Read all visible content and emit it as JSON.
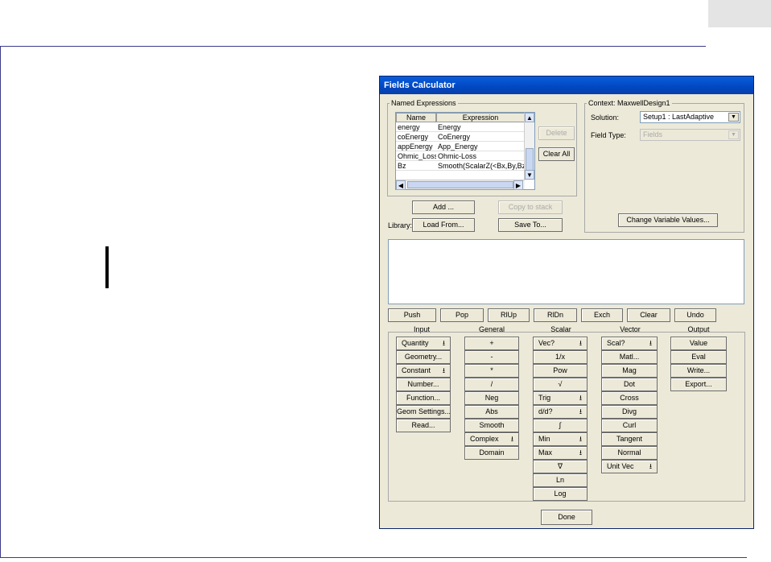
{
  "dialog": {
    "title": "Fields Calculator",
    "named_expressions": {
      "legend": "Named Expressions",
      "columns": [
        "Name",
        "Expression"
      ],
      "rows": [
        {
          "name": "energy",
          "expr": "Energy"
        },
        {
          "name": "coEnergy",
          "expr": "CoEnergy"
        },
        {
          "name": "appEnergy",
          "expr": "App_Energy"
        },
        {
          "name": "Ohmic_Loss",
          "expr": "Ohmic-Loss"
        },
        {
          "name": "Bz",
          "expr": "Smooth(ScalarZ(<Bx,By,Bz>))"
        }
      ],
      "delete": "Delete",
      "clear_all": "Clear All"
    },
    "context": {
      "legend": "Context: MaxwellDesign1",
      "solution_label": "Solution:",
      "solution_value": "Setup1 : LastAdaptive",
      "field_type_label": "Field Type:",
      "field_type_value": "Fields",
      "change_vars": "Change Variable Values..."
    },
    "add": "Add ...",
    "copy_to_stack": "Copy to stack",
    "library_label": "Library:",
    "load_from": "Load From...",
    "save_to": "Save To...",
    "stack_buttons": [
      "Push",
      "Pop",
      "RlUp",
      "RlDn",
      "Exch",
      "Clear",
      "Undo"
    ],
    "columns": {
      "input": {
        "title": "Input",
        "items": [
          "Quantity",
          "Geometry...",
          "Constant",
          "Number...",
          "Function...",
          "Geom Settings...",
          "Read..."
        ]
      },
      "general": {
        "title": "General",
        "items": [
          "+",
          "-",
          "*",
          "/",
          "Neg",
          "Abs",
          "Smooth",
          "Complex",
          "Domain"
        ]
      },
      "scalar": {
        "title": "Scalar",
        "items": [
          "Vec?",
          "1/x",
          "Pow",
          "√",
          "Trig",
          "d/d?",
          "∫",
          "Min",
          "Max",
          "∇",
          "Ln",
          "Log"
        ]
      },
      "vector": {
        "title": "Vector",
        "items": [
          "Scal?",
          "Matl...",
          "Mag",
          "Dot",
          "Cross",
          "Divg",
          "Curl",
          "Tangent",
          "Normal",
          "Unit Vec"
        ]
      },
      "output": {
        "title": "Output",
        "items": [
          "Value",
          "Eval",
          "Write...",
          "Export..."
        ]
      }
    },
    "done": "Done",
    "dropdown_icon": "down-arrow-icon"
  }
}
